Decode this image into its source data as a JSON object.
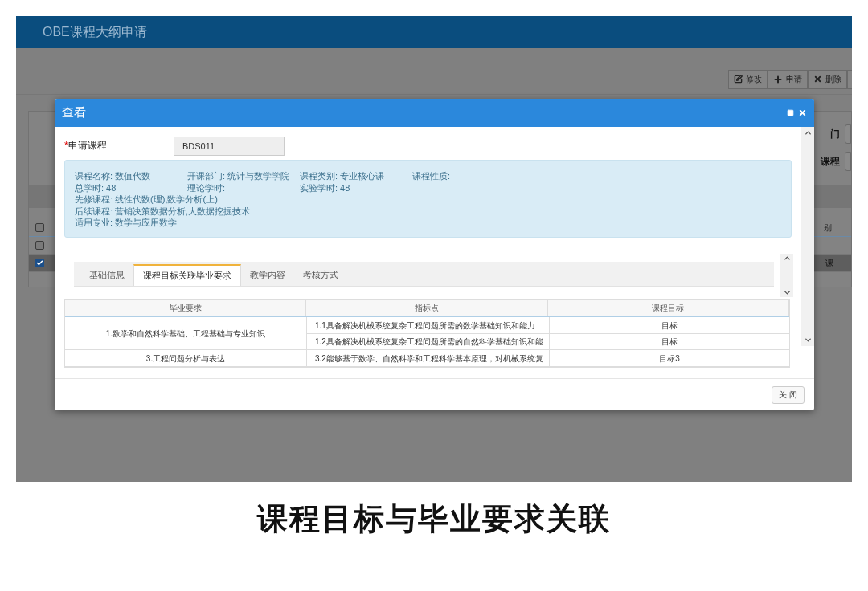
{
  "app_title": "OBE课程大纲申请",
  "background": {
    "toolbar_buttons": [
      {
        "kind": "edit",
        "label": "修改"
      },
      {
        "kind": "add",
        "label": "申请"
      },
      {
        "kind": "delete",
        "label": "删除"
      }
    ],
    "filter_labels": [
      "门",
      "课程"
    ],
    "table": {
      "column_label": "别",
      "header_checked": false,
      "rows": [
        {
          "checked": false,
          "selected": false,
          "cell": ""
        },
        {
          "checked": true,
          "selected": true,
          "cell": "课"
        }
      ]
    }
  },
  "dialog": {
    "title": "查看",
    "field": {
      "label": "申请课程",
      "required_mark": "*",
      "value": "BDS011"
    },
    "info": {
      "grid_rows": [
        [
          "课程名称: 数值代数",
          "开课部门: 统计与数学学院",
          "课程类别: 专业核心课",
          "课程性质:"
        ],
        [
          "总学时: 48",
          "理论学时:",
          "实验学时: 48"
        ]
      ],
      "lines": [
        "先修课程: 线性代数(理),数学分析(上)",
        "后续课程: 营销决策数据分析,大数据挖掘技术",
        "适用专业: 数学与应用数学"
      ]
    },
    "tabs": [
      {
        "label": "基础信息",
        "selected": false
      },
      {
        "label": "课程目标关联毕业要求",
        "selected": true
      },
      {
        "label": "教学内容",
        "selected": false
      },
      {
        "label": "考核方式",
        "selected": false
      }
    ],
    "table": {
      "columns": [
        "毕业要求",
        "指标点",
        "课程目标"
      ],
      "groups": [
        {
          "requirement": "1.数学和自然科学基础、工程基础与专业知识",
          "items": [
            {
              "indicator": "1.1具备解决机械系统复杂工程问题所需的数学基础知识和能力",
              "goal": "目标"
            },
            {
              "indicator": "1.2具备解决机械系统复杂工程问题所需的自然科学基础知识和能",
              "goal": "目标"
            }
          ]
        },
        {
          "requirement": "3.工程问题分析与表达",
          "items": [
            {
              "indicator": "3.2能够基于数学、自然科学和工程科学基本原理，对机械系统复",
              "goal": "目标3"
            }
          ]
        }
      ]
    },
    "close_button": "关 闭"
  },
  "caption": "课程目标与毕业要求关联"
}
